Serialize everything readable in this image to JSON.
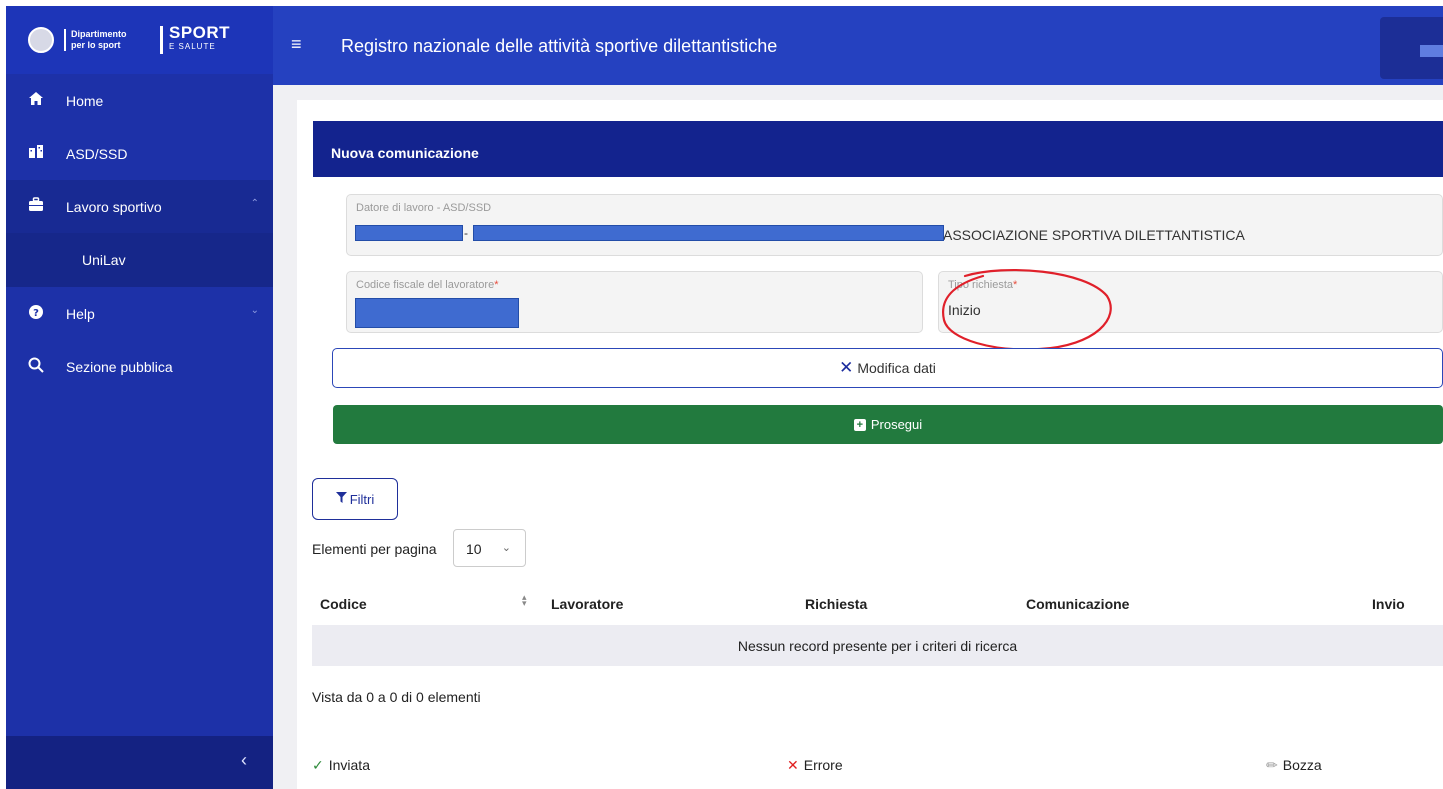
{
  "sidebar": {
    "brand": {
      "department": "Dipartimento per lo sport",
      "logo_main": "SPORT",
      "logo_sub": "E SALUTE"
    },
    "items": [
      {
        "label": "Home",
        "icon": "home-icon"
      },
      {
        "label": "ASD/SSD",
        "icon": "building-icon"
      },
      {
        "label": "Lavoro sportivo",
        "icon": "briefcase-icon",
        "expanded": true
      },
      {
        "label": "Help",
        "icon": "help-icon",
        "expanded": false
      },
      {
        "label": "Sezione pubblica",
        "icon": "search-icon"
      }
    ],
    "subitems": [
      {
        "label": "UniLav"
      }
    ]
  },
  "header": {
    "title": "Registro nazionale delle attività sportive dilettantistiche"
  },
  "form": {
    "title": "Nuova comunicazione",
    "employer": {
      "label": "Datore di lavoro - ASD/SSD",
      "value_suffix": "ASSOCIAZIONE SPORTIVA DILETTANTISTICA"
    },
    "worker_tax_code": {
      "label": "Codice fiscale del lavoratore"
    },
    "request_type": {
      "label": "Tipo richiesta",
      "value": "Inizio"
    },
    "required_marker": "*",
    "edit_button": "Modifica dati",
    "continue_button": "Prosegui"
  },
  "list": {
    "filter_button": "Filtri",
    "per_page_label": "Elementi per pagina",
    "per_page_value": "10",
    "columns": [
      "Codice",
      "Lavoratore",
      "Richiesta",
      "Comunicazione",
      "Invio"
    ],
    "empty_message": "Nessun record presente per i criteri di ricerca",
    "pagination_info": "Vista da 0 a 0 di 0 elementi"
  },
  "legend": {
    "sent": "Inviata",
    "error": "Errore",
    "draft": "Bozza"
  },
  "colors": {
    "sidebar": "#1d31a8",
    "header": "#2541c0",
    "form_header": "#13238e",
    "continue_button": "#227a3e",
    "annotation": "#e0202a"
  }
}
